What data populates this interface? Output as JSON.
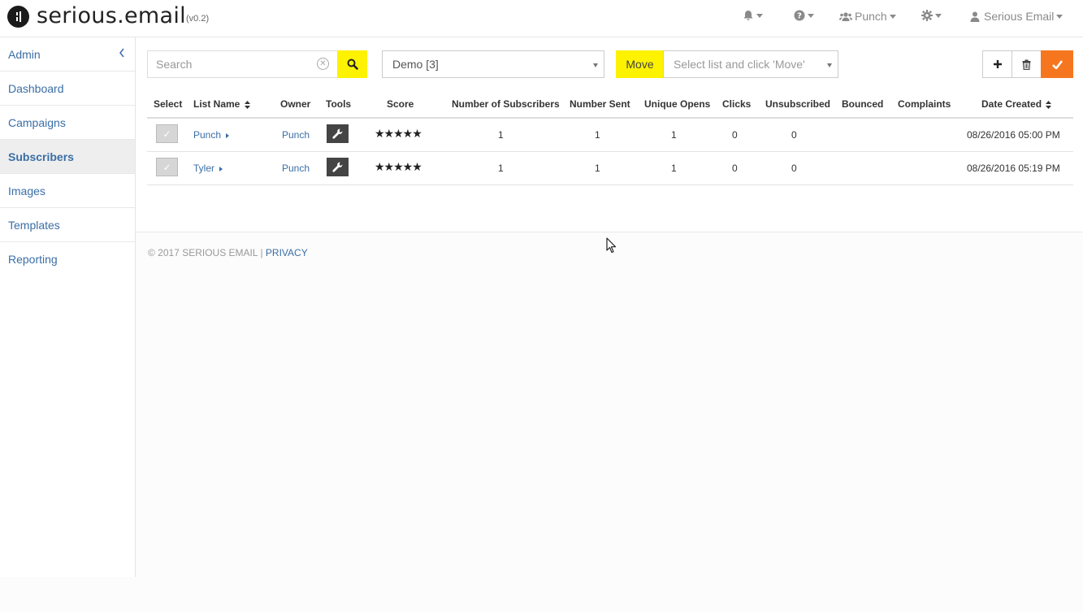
{
  "app": {
    "name": "serious.email",
    "version": "(v0.2)"
  },
  "topnav": {
    "notifications_icon": "bell-icon",
    "help_icon": "question-circle-icon",
    "team_label": "Punch",
    "settings_icon": "gear-icon",
    "user_label": "Serious Email"
  },
  "sidebar": {
    "items": [
      {
        "label": "Admin"
      },
      {
        "label": "Dashboard"
      },
      {
        "label": "Campaigns"
      },
      {
        "label": "Subscribers"
      },
      {
        "label": "Images"
      },
      {
        "label": "Templates"
      },
      {
        "label": "Reporting"
      }
    ]
  },
  "toolbar": {
    "search_placeholder": "Search",
    "list_select_value": "Demo [3]",
    "move_label": "Move",
    "move_select_placeholder": "Select list and click 'Move'"
  },
  "table": {
    "headers": {
      "select": "Select",
      "list_name": "List Name",
      "owner": "Owner",
      "tools": "Tools",
      "score": "Score",
      "subscribers": "Number of Subscribers",
      "sent": "Number Sent",
      "opens": "Unique Opens",
      "clicks": "Clicks",
      "unsubscribed": "Unsubscribed",
      "bounced": "Bounced",
      "complaints": "Complaints",
      "date_created": "Date Created"
    },
    "rows": [
      {
        "name": "Punch",
        "owner": "Punch",
        "score": "★★★★★",
        "subscribers": "1",
        "sent": "1",
        "opens": "1",
        "clicks": "0",
        "unsubscribed": "0",
        "bounced": "",
        "complaints": "",
        "date": "08/26/2016 05:00 PM"
      },
      {
        "name": "Tyler",
        "owner": "Punch",
        "score": "★★★★★",
        "subscribers": "1",
        "sent": "1",
        "opens": "1",
        "clicks": "0",
        "unsubscribed": "0",
        "bounced": "",
        "complaints": "",
        "date": "08/26/2016 05:19 PM"
      }
    ]
  },
  "footer": {
    "copyright": "© 2017 SERIOUS EMAIL | ",
    "privacy_label": "PRIVACY"
  },
  "colors": {
    "accent_yellow": "#fdf200",
    "accent_orange": "#f5761f",
    "link_blue": "#3a6ea5"
  }
}
